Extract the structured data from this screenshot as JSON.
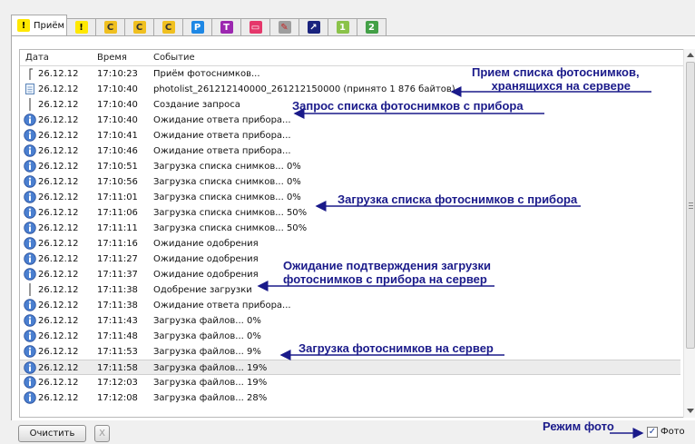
{
  "tabs": [
    {
      "label": "Приём",
      "icon": "exclamation-icon",
      "glyph": "!",
      "bg": "#ffe800",
      "fg": "#000"
    },
    {
      "label": "",
      "icon": "exclamation-icon",
      "glyph": "!",
      "bg": "#ffe800",
      "fg": "#000"
    },
    {
      "label": "",
      "icon": "c-icon",
      "glyph": "C",
      "bg": "#f0c020",
      "fg": "#333"
    },
    {
      "label": "",
      "icon": "c-icon",
      "glyph": "C",
      "bg": "#f0c020",
      "fg": "#333"
    },
    {
      "label": "",
      "icon": "c-icon",
      "glyph": "C",
      "bg": "#f0c020",
      "fg": "#333"
    },
    {
      "label": "",
      "icon": "p-icon",
      "glyph": "P",
      "bg": "#1e88e5",
      "fg": "#fff"
    },
    {
      "label": "",
      "icon": "t-icon",
      "glyph": "T",
      "bg": "#9c27b0",
      "fg": "#fff"
    },
    {
      "label": "",
      "icon": "gamepad-icon",
      "glyph": "▭",
      "bg": "#e5376b",
      "fg": "#fff"
    },
    {
      "label": "",
      "icon": "edit-icon",
      "glyph": "✎",
      "bg": "#9e9e9e",
      "fg": "#c62828"
    },
    {
      "label": "",
      "icon": "chart-icon",
      "glyph": "↗",
      "bg": "#1a237e",
      "fg": "#fff"
    },
    {
      "label": "",
      "icon": "one-icon",
      "glyph": "1",
      "bg": "#8bc34a",
      "fg": "#fff"
    },
    {
      "label": "",
      "icon": "two-icon",
      "glyph": "2",
      "bg": "#43a047",
      "fg": "#fff"
    }
  ],
  "columns": {
    "date": "Дата",
    "time": "Время",
    "event": "Событие"
  },
  "rows": [
    {
      "icon": "bracket",
      "date": "26.12.12",
      "time": "17:10:23",
      "event": "Приём фотоснимков..."
    },
    {
      "icon": "doc",
      "date": "26.12.12",
      "time": "17:10:40",
      "event": "photolist_261212140000_261212150000 (принято 1 876 байтов)"
    },
    {
      "icon": "line",
      "date": "26.12.12",
      "time": "17:10:40",
      "event": "Создание запроса"
    },
    {
      "icon": "info",
      "date": "26.12.12",
      "time": "17:10:40",
      "event": "Ожидание ответа прибора..."
    },
    {
      "icon": "info",
      "date": "26.12.12",
      "time": "17:10:41",
      "event": "Ожидание ответа прибора..."
    },
    {
      "icon": "info",
      "date": "26.12.12",
      "time": "17:10:46",
      "event": "Ожидание ответа прибора..."
    },
    {
      "icon": "info",
      "date": "26.12.12",
      "time": "17:10:51",
      "event": "Загрузка списка снимков... 0%"
    },
    {
      "icon": "info",
      "date": "26.12.12",
      "time": "17:10:56",
      "event": "Загрузка списка снимков... 0%"
    },
    {
      "icon": "info",
      "date": "26.12.12",
      "time": "17:11:01",
      "event": "Загрузка списка снимков... 0%"
    },
    {
      "icon": "info",
      "date": "26.12.12",
      "time": "17:11:06",
      "event": "Загрузка списка снимков... 50%"
    },
    {
      "icon": "info",
      "date": "26.12.12",
      "time": "17:11:11",
      "event": "Загрузка списка снимков... 50%"
    },
    {
      "icon": "info",
      "date": "26.12.12",
      "time": "17:11:16",
      "event": "Ожидание одобрения"
    },
    {
      "icon": "info",
      "date": "26.12.12",
      "time": "17:11:27",
      "event": "Ожидание одобрения"
    },
    {
      "icon": "info",
      "date": "26.12.12",
      "time": "17:11:37",
      "event": "Ожидание одобрения"
    },
    {
      "icon": "line",
      "date": "26.12.12",
      "time": "17:11:38",
      "event": "Одобрение загрузки"
    },
    {
      "icon": "info",
      "date": "26.12.12",
      "time": "17:11:38",
      "event": "Ожидание ответа прибора..."
    },
    {
      "icon": "info",
      "date": "26.12.12",
      "time": "17:11:43",
      "event": "Загрузка файлов... 0%"
    },
    {
      "icon": "info",
      "date": "26.12.12",
      "time": "17:11:48",
      "event": "Загрузка файлов... 0%"
    },
    {
      "icon": "info",
      "date": "26.12.12",
      "time": "17:11:53",
      "event": "Загрузка файлов... 9%"
    },
    {
      "icon": "info",
      "date": "26.12.12",
      "time": "17:11:58",
      "event": "Загрузка файлов... 19%",
      "selected": true
    },
    {
      "icon": "info",
      "date": "26.12.12",
      "time": "17:12:03",
      "event": "Загрузка файлов... 19%"
    },
    {
      "icon": "info",
      "date": "26.12.12",
      "time": "17:12:08",
      "event": "Загрузка файлов... 28%"
    }
  ],
  "annotations": {
    "a1_line1": "Прием списка фотоснимков,",
    "a1_line2": "хранящихся на сервере",
    "a2": "Запрос списка фотоснимков с прибора",
    "a3": "Загрузка списка фотоснимков с прибора",
    "a4_line1": "Ожидание подтверждения загрузки",
    "a4_line2": "фотоснимков с прибора на сервер",
    "a5": "Загрузка фотоснимков на сервер",
    "a6": "Режим фото"
  },
  "footer": {
    "clear_label": "Очистить",
    "x_label": "X",
    "photo_label": "Фото",
    "photo_checked": true,
    "check_glyph": "✓"
  },
  "colors": {
    "annotation": "#1a1a8a",
    "info_icon": "#3a6fc4"
  }
}
